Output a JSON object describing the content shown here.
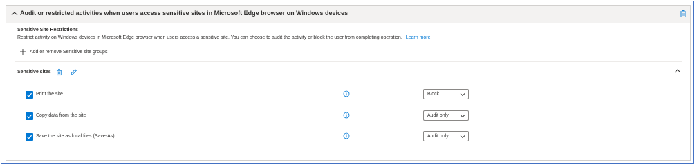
{
  "section": {
    "title": "Audit or restricted activities when users access sensitive sites in Microsoft Edge browser on Windows devices"
  },
  "restrictions": {
    "heading": "Sensitive Site Restrictions",
    "description": "Restrict activity on Windows devices in Microsoft Edge browser when users access a sensitive site. You can choose to audit the activity or block the user from completing operation.",
    "learn_more": "Learn more",
    "add_groups_label": "Add or remove Sensitive site groups"
  },
  "sensitive_sites": {
    "label": "Sensitive sites",
    "rows": [
      {
        "label": "Print the site",
        "checked": true,
        "action": "Block"
      },
      {
        "label": "Copy data from the site",
        "checked": true,
        "action": "Audit only"
      },
      {
        "label": "Save the site as local files (Save-As)",
        "checked": true,
        "action": "Audit only"
      }
    ]
  },
  "colors": {
    "accent": "#0078d4",
    "frame_border": "#4472c4",
    "header_bg": "#f3f2f1",
    "text": "#323130"
  },
  "icons": {
    "header_collapse": "chevron-up-icon",
    "header_delete": "trash-icon",
    "add": "plus-icon",
    "sites_delete": "trash-icon",
    "sites_edit": "pencil-icon",
    "sites_collapse": "chevron-up-icon",
    "info": "info-icon",
    "dropdown": "chevron-down-icon"
  }
}
